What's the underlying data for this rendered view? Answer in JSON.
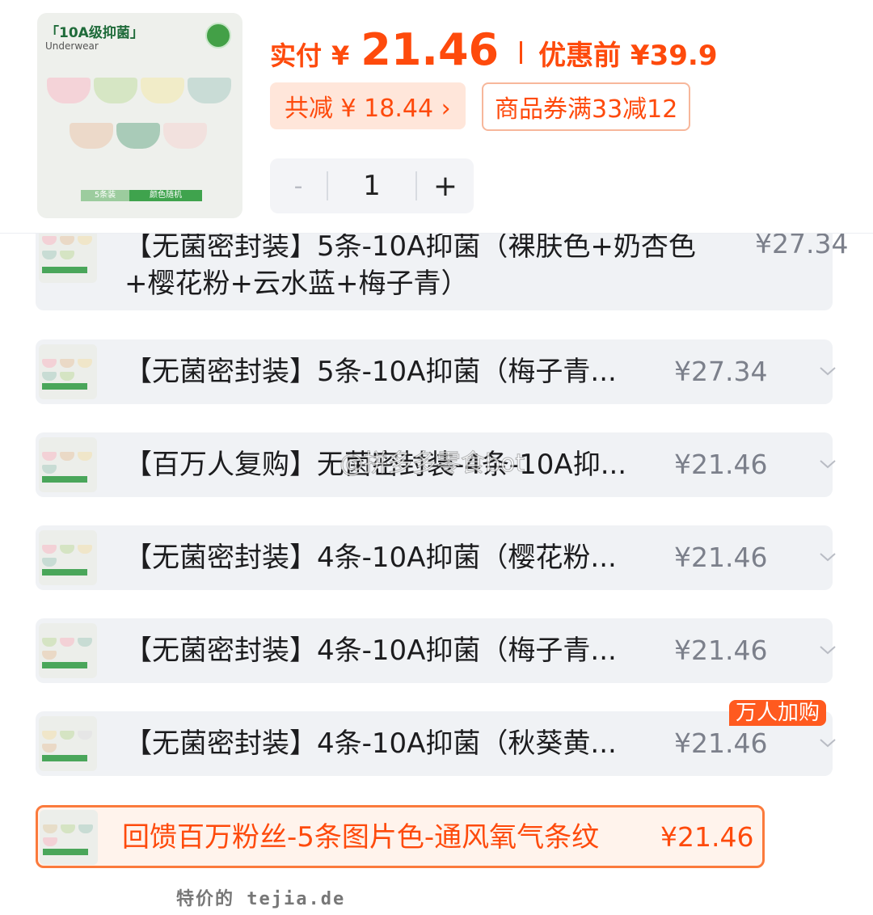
{
  "header": {
    "hero": {
      "tag": "「10A级抑菌」",
      "sub": "Underwear",
      "pack_count": "5条装",
      "pack_note": "颜色随机"
    },
    "pay_label": "实付",
    "currency": "¥",
    "pay_value": "21.46",
    "orig_label": "优惠前 ¥39.9",
    "discount_label": "共减 ¥ 18.44 ›",
    "coupon_label": "商品券满33减12",
    "stepper": {
      "minus": "-",
      "qty": "1",
      "plus": "+"
    }
  },
  "items": [
    {
      "title": "【无菌密封装】5条-10A抑菌（裸肤色+奶杏色+樱花粉+云水蓝+梅子青）",
      "price": "¥27.34"
    },
    {
      "title": "【无菌密封装】5条-10A抑菌（梅子青...",
      "price": "¥27.34"
    },
    {
      "title": "【百万人复购】无菌密封装-4条-10A抑...",
      "price": "¥21.46"
    },
    {
      "title": "【无菌密封装】4条-10A抑菌（樱花粉...",
      "price": "¥21.46"
    },
    {
      "title": "【无菌密封装】4条-10A抑菌（梅子青...",
      "price": "¥21.46"
    },
    {
      "title": "【无菌密封装】4条-10A抑菌（秋葵黄...",
      "price": "¥21.46",
      "badge": "万人加购"
    },
    {
      "title": "回馈百万粉丝-5条图片色-通风氧气条纹",
      "price": "¥21.46"
    }
  ],
  "watermark": "@拼多多零食bot",
  "footer": "特价的 tejia.de",
  "colors": {
    "accent": "#fe4a0c",
    "row_bg": "#f0f2f5",
    "muted_price": "#7c808b"
  }
}
